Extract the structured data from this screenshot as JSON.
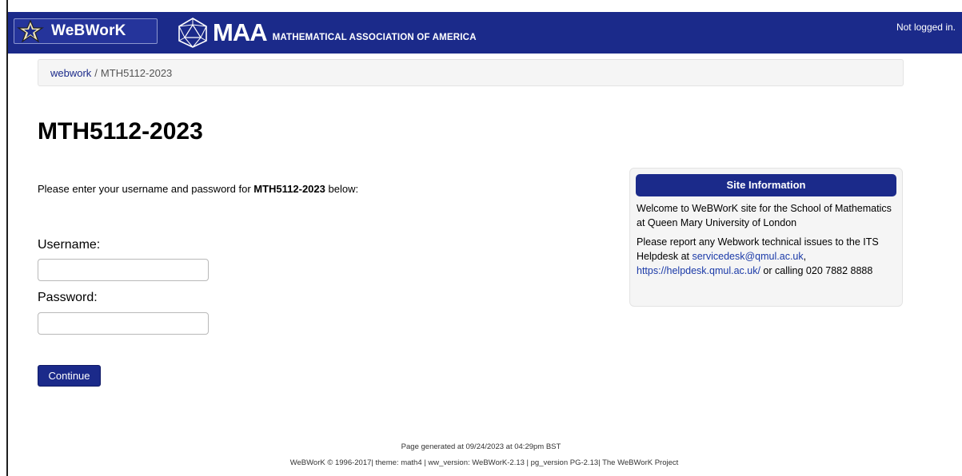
{
  "header": {
    "webwork_logo_text": "WeBWorK",
    "maa_logo_big": "MAA",
    "maa_logo_small": "MATHEMATICAL ASSOCIATION OF AMERICA",
    "login_status": "Not logged in."
  },
  "breadcrumb": {
    "root_link": "webwork",
    "separator": "/",
    "current": "MTH5112-2023"
  },
  "main": {
    "title": "MTH5112-2023",
    "intro_prefix": "Please enter your username and password for ",
    "intro_course": "MTH5112-2023",
    "intro_suffix": " below:",
    "username_label": "Username:",
    "username_value": "",
    "password_label": "Password:",
    "password_value": "",
    "continue_label": "Continue"
  },
  "site_info": {
    "heading": "Site Information",
    "welcome": "Welcome to WeBWorK site for the School of Mathematics at Queen Mary University of London",
    "report_prefix": "Please report any Webwork technical issues to the ITS Helpdesk at ",
    "email_link": "servicedesk@qmul.ac.uk",
    "comma": ",",
    "helpdesk_link": "https://helpdesk.qmul.ac.uk/",
    "report_suffix": " or calling 020 7882 8888"
  },
  "footer": {
    "generated": "Page generated at 09/24/2023 at 04:29pm BST",
    "credits_prefix": "WeBWorK © 1996-2017| theme: math4 | ww_version: WeBWorK-2.13 | pg_version PG-2.13| ",
    "project_link": "The WeBWorK Project"
  },
  "colors": {
    "brand_navy": "#1b2a8a",
    "panel_bg": "#f5f5f5",
    "link_blue": "#1b3aa8"
  },
  "icons": {
    "webwork_logo": "webwork-star-icon",
    "maa_logo": "maa-icosahedron-icon"
  }
}
